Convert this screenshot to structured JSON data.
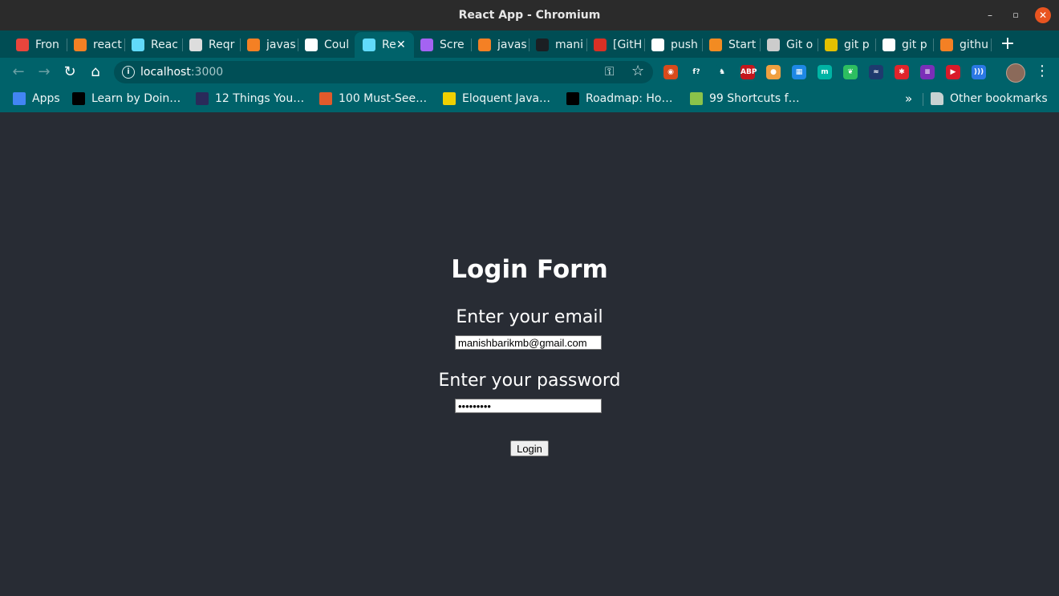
{
  "window": {
    "title": "React App - Chromium",
    "controls": {
      "minimize": "–",
      "maximize": "▫",
      "close": "✕"
    }
  },
  "tabs": [
    {
      "label": "Fron",
      "icon": "grid-icon",
      "color": "#e8453c"
    },
    {
      "label": "react",
      "icon": "stackoverflow-icon",
      "color": "#f48024"
    },
    {
      "label": "Reac",
      "icon": "react-icon",
      "color": "#61dafb"
    },
    {
      "label": "Reqr",
      "icon": "globe-icon",
      "color": "#dddddd"
    },
    {
      "label": "javas",
      "icon": "stackoverflow-icon",
      "color": "#f48024"
    },
    {
      "label": "Coul",
      "icon": "google-icon",
      "color": "#ffffff"
    },
    {
      "label": "Re",
      "icon": "react-icon",
      "color": "#61dafb",
      "active": true
    },
    {
      "label": "Scre",
      "icon": "feather-icon",
      "color": "#a463f2"
    },
    {
      "label": "javas",
      "icon": "stackoverflow-icon",
      "color": "#f48024"
    },
    {
      "label": "mani",
      "icon": "github-icon",
      "color": "#1b1f23"
    },
    {
      "label": "[GitH",
      "icon": "gmail-icon",
      "color": "#d93025"
    },
    {
      "label": "push",
      "icon": "google-icon",
      "color": "#ffffff"
    },
    {
      "label": "Start",
      "icon": "box-icon",
      "color": "#f28b22"
    },
    {
      "label": "Git o",
      "icon": "book-icon",
      "color": "#cccccc"
    },
    {
      "label": "git p",
      "icon": "layers-icon",
      "color": "#e4c000"
    },
    {
      "label": "git p",
      "icon": "google-icon",
      "color": "#ffffff"
    },
    {
      "label": "githu",
      "icon": "stackoverflow-icon",
      "color": "#f48024"
    }
  ],
  "new_tab": "+",
  "address_bar": {
    "host": "localhost",
    "port": ":3000"
  },
  "nav": {
    "back": "←",
    "forward": "→",
    "reload": "↻",
    "home": "⌂"
  },
  "extensions": [
    {
      "icon": "bug-icon",
      "color": "#d84a1b",
      "text": "◉"
    },
    {
      "icon": "function-icon",
      "color": "#00626a",
      "text": "f?"
    },
    {
      "icon": "gnome-icon",
      "color": "#00626a",
      "text": "♞"
    },
    {
      "icon": "adblock-icon",
      "color": "#c4161c",
      "text": "ABP"
    },
    {
      "icon": "capsule-icon",
      "color": "#f0a040",
      "text": "●"
    },
    {
      "icon": "window-icon",
      "color": "#1e88e5",
      "text": "▦"
    },
    {
      "icon": "m-circle-icon",
      "color": "#00b3a4",
      "text": "m"
    },
    {
      "icon": "evernote-icon",
      "color": "#2dbe60",
      "text": "❦"
    },
    {
      "icon": "wave-icon",
      "color": "#1e3a6e",
      "text": "≈"
    },
    {
      "icon": "red-puzzle-icon",
      "color": "#e0242b",
      "text": "✱"
    },
    {
      "icon": "stack-icon",
      "color": "#7b2fb8",
      "text": "≡"
    },
    {
      "icon": "youtube-icon",
      "color": "#d91a2a",
      "text": "▶"
    },
    {
      "icon": "signal-icon",
      "color": "#2b78e4",
      "text": ")))"
    }
  ],
  "bookmarks": {
    "items": [
      {
        "label": "Apps",
        "icon": "apps-grid-icon",
        "color": "#4285f4"
      },
      {
        "label": "Learn by Doin…",
        "icon": "medium-icon",
        "color": "#000000"
      },
      {
        "label": "12 Things You…",
        "icon": "zigzag-icon",
        "color": "#2a2a5a"
      },
      {
        "label": "100 Must-See…",
        "icon": "codecademy-icon",
        "color": "#e05a2b"
      },
      {
        "label": "Eloquent Java…",
        "icon": "ejs-icon",
        "color": "#f0d000"
      },
      {
        "label": "Roadmap: Ho…",
        "icon": "medium-icon",
        "color": "#000000"
      },
      {
        "label": "99 Shortcuts f…",
        "icon": "sprout-icon",
        "color": "#8bc34a"
      }
    ],
    "more": "»",
    "other": "Other bookmarks"
  },
  "form": {
    "heading": "Login Form",
    "email_label": "Enter your email",
    "email_value": "manishbarikmb@gmail.com",
    "password_label": "Enter your password",
    "password_value": "•••••••••",
    "submit_label": "Login"
  }
}
